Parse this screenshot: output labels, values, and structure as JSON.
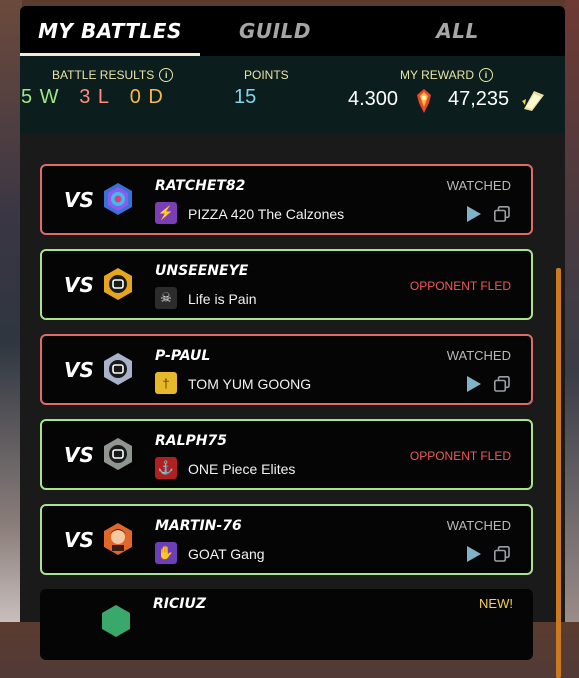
{
  "tabs": [
    {
      "label": "MY BATTLES",
      "active": true
    },
    {
      "label": "GUILD",
      "active": false
    },
    {
      "label": "ALL",
      "active": false
    }
  ],
  "stats": {
    "battle_results_label": "BATTLE RESULTS",
    "wins": "5 W",
    "losses": "3 L",
    "draws": "0 D",
    "points_label": "POINTS",
    "points": "15",
    "reward_label": "MY REWARD",
    "reward_1": "4.300",
    "reward_1_icon": "sps-token-icon",
    "reward_2": "47,235",
    "reward_2_icon": "merits-icon"
  },
  "battles": [
    {
      "vs": "VS",
      "opponent": "RATCHET82",
      "guild": "PIZZA 420 The Calzones",
      "status": "WATCHED",
      "result": "loss",
      "avatar": "diamond-league-icon",
      "guild_icon": "lightning-icon",
      "guild_color": "#7b3fb5"
    },
    {
      "vs": "VS",
      "opponent": "UNSEENEYE",
      "guild": "Life is Pain",
      "status": "OPPONENT FLED",
      "result": "win",
      "avatar": "gold-league-icon",
      "guild_icon": "skull-icon",
      "guild_color": "#2c2c2c"
    },
    {
      "vs": "VS",
      "opponent": "P-PAUL",
      "guild": "TOM YUM GOONG",
      "status": "WATCHED",
      "result": "loss",
      "avatar": "silver-league-icon",
      "guild_icon": "sword-icon",
      "guild_color": "#e6b82a"
    },
    {
      "vs": "VS",
      "opponent": "RALPH75",
      "guild": "ONE Piece Elites",
      "status": "OPPONENT FLED",
      "result": "win",
      "avatar": "silver-league-icon",
      "guild_icon": "ship-icon",
      "guild_color": "#b02020"
    },
    {
      "vs": "VS",
      "opponent": "MARTIN-76",
      "guild": "GOAT Gang",
      "status": "WATCHED",
      "result": "win",
      "avatar": "character-avatar-icon",
      "guild_icon": "hand-icon",
      "guild_color": "#6a3fb8"
    },
    {
      "vs": "VS",
      "opponent": "RICIUZ",
      "guild": "",
      "status": "NEW!",
      "result": "pending",
      "avatar": "league-icon",
      "guild_icon": "",
      "guild_color": ""
    }
  ]
}
